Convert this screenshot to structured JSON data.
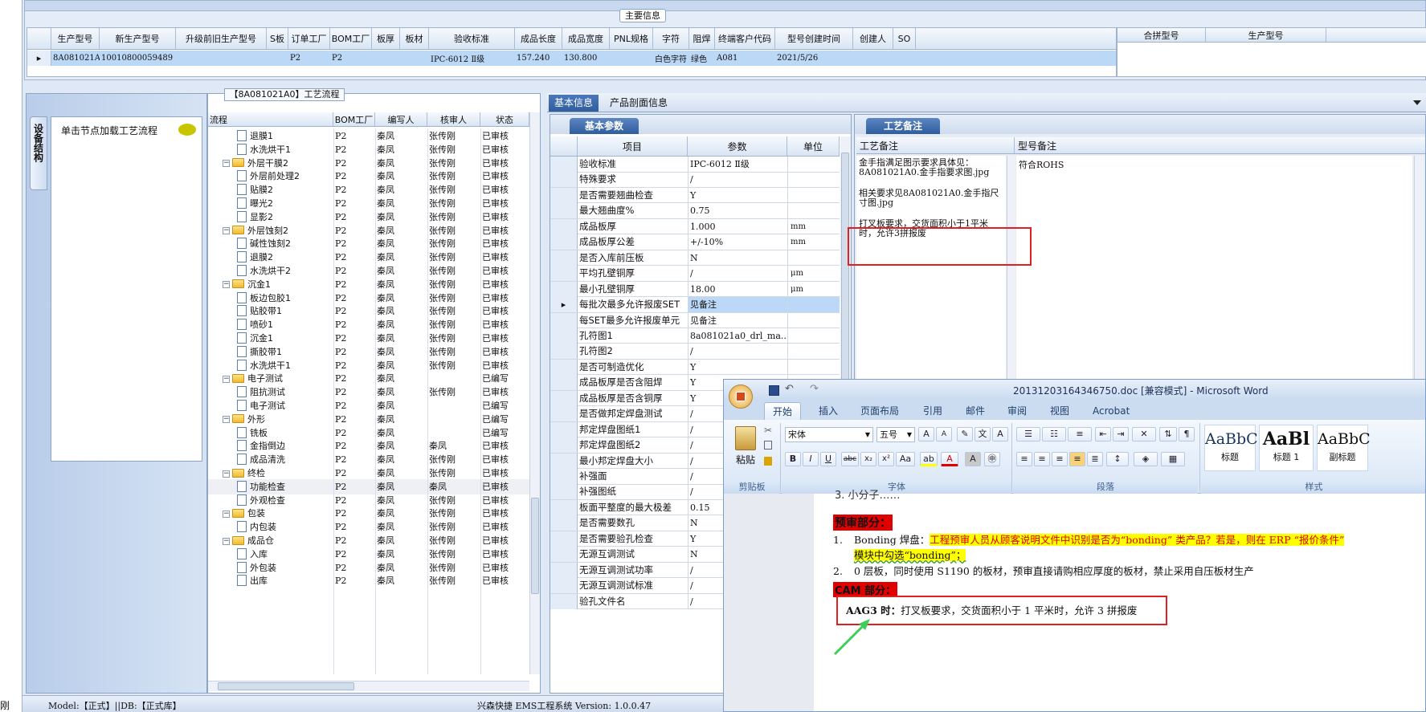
{
  "main_info": {
    "title": "主要信息",
    "headers": [
      "生产型号",
      "新生产型号",
      "升级前旧生产型号",
      "S板",
      "订单工厂",
      "BOM工厂",
      "板厚",
      "板材",
      "验收标准",
      "成品长度",
      "成品宽度",
      "PNL规格",
      "字符",
      "阻焊",
      "终端客户代码",
      "型号创建时间",
      "创建人",
      "SO"
    ],
    "row": [
      "8A081021A0",
      "10010800059489",
      "",
      "",
      "P2",
      "P2",
      "",
      "",
      "IPC-6012 Ⅱ级",
      "157.240",
      "130.800",
      "",
      "白色字符",
      "绿色",
      "A081",
      "2021/5/26",
      "",
      ""
    ],
    "side_headers": [
      "合拼型号",
      "生产型号"
    ]
  },
  "left_panel": {
    "vertical_tab": "设备结构",
    "hint": "单击节点加载工艺流程"
  },
  "flow": {
    "title": "【8A081021A0】工艺流程",
    "headers": [
      "流程",
      "BOM工厂",
      "编写人",
      "核审人",
      "状态"
    ],
    "rows": [
      {
        "name": "退膜1",
        "level": 2,
        "folder": false,
        "bom": "P2",
        "writer": "秦凤",
        "reviewer": "张传刚",
        "status": "已审核"
      },
      {
        "name": "水洗烘干1",
        "level": 2,
        "folder": false,
        "bom": "P2",
        "writer": "秦凤",
        "reviewer": "张传刚",
        "status": "已审核"
      },
      {
        "name": "外层干膜2",
        "level": 1,
        "folder": true,
        "bom": "P2",
        "writer": "秦凤",
        "reviewer": "张传刚",
        "status": "已审核"
      },
      {
        "name": "外层前处理2",
        "level": 2,
        "folder": false,
        "bom": "P2",
        "writer": "秦凤",
        "reviewer": "张传刚",
        "status": "已审核"
      },
      {
        "name": "贴膜2",
        "level": 2,
        "folder": false,
        "bom": "P2",
        "writer": "秦凤",
        "reviewer": "张传刚",
        "status": "已审核"
      },
      {
        "name": "曝光2",
        "level": 2,
        "folder": false,
        "bom": "P2",
        "writer": "秦凤",
        "reviewer": "张传刚",
        "status": "已审核"
      },
      {
        "name": "显影2",
        "level": 2,
        "folder": false,
        "bom": "P2",
        "writer": "秦凤",
        "reviewer": "张传刚",
        "status": "已审核"
      },
      {
        "name": "外层蚀刻2",
        "level": 1,
        "folder": true,
        "bom": "P2",
        "writer": "秦凤",
        "reviewer": "张传刚",
        "status": "已审核"
      },
      {
        "name": "碱性蚀刻2",
        "level": 2,
        "folder": false,
        "bom": "P2",
        "writer": "秦凤",
        "reviewer": "张传刚",
        "status": "已审核"
      },
      {
        "name": "退膜2",
        "level": 2,
        "folder": false,
        "bom": "P2",
        "writer": "秦凤",
        "reviewer": "张传刚",
        "status": "已审核"
      },
      {
        "name": "水洗烘干2",
        "level": 2,
        "folder": false,
        "bom": "P2",
        "writer": "秦凤",
        "reviewer": "张传刚",
        "status": "已审核"
      },
      {
        "name": "沉金1",
        "level": 1,
        "folder": true,
        "bom": "P2",
        "writer": "秦凤",
        "reviewer": "张传刚",
        "status": "已审核"
      },
      {
        "name": "板边包胶1",
        "level": 2,
        "folder": false,
        "bom": "P2",
        "writer": "秦凤",
        "reviewer": "张传刚",
        "status": "已审核"
      },
      {
        "name": "贴胶带1",
        "level": 2,
        "folder": false,
        "bom": "P2",
        "writer": "秦凤",
        "reviewer": "张传刚",
        "status": "已审核"
      },
      {
        "name": "喷砂1",
        "level": 2,
        "folder": false,
        "bom": "P2",
        "writer": "秦凤",
        "reviewer": "张传刚",
        "status": "已审核"
      },
      {
        "name": "沉金1",
        "level": 2,
        "folder": false,
        "bom": "P2",
        "writer": "秦凤",
        "reviewer": "张传刚",
        "status": "已审核"
      },
      {
        "name": "撕胶带1",
        "level": 2,
        "folder": false,
        "bom": "P2",
        "writer": "秦凤",
        "reviewer": "张传刚",
        "status": "已审核"
      },
      {
        "name": "水洗烘干1",
        "level": 2,
        "folder": false,
        "bom": "P2",
        "writer": "秦凤",
        "reviewer": "张传刚",
        "status": "已审核"
      },
      {
        "name": "电子测试",
        "level": 1,
        "folder": true,
        "bom": "P2",
        "writer": "秦凤",
        "reviewer": "",
        "status": "已编写"
      },
      {
        "name": "阻抗测试",
        "level": 2,
        "folder": false,
        "bom": "P2",
        "writer": "秦凤",
        "reviewer": "张传刚",
        "status": "已审核"
      },
      {
        "name": "电子测试",
        "level": 2,
        "folder": false,
        "bom": "P2",
        "writer": "秦凤",
        "reviewer": "",
        "status": "已编写"
      },
      {
        "name": "外形",
        "level": 1,
        "folder": true,
        "bom": "P2",
        "writer": "秦凤",
        "reviewer": "",
        "status": "已编写"
      },
      {
        "name": "铣板",
        "level": 2,
        "folder": false,
        "bom": "P2",
        "writer": "秦凤",
        "reviewer": "",
        "status": "已编写"
      },
      {
        "name": "金指倒边",
        "level": 2,
        "folder": false,
        "bom": "P2",
        "writer": "秦凤",
        "reviewer": "秦凤",
        "status": "已审核"
      },
      {
        "name": "成品清洗",
        "level": 2,
        "folder": false,
        "bom": "P2",
        "writer": "秦凤",
        "reviewer": "张传刚",
        "status": "已审核"
      },
      {
        "name": "终检",
        "level": 1,
        "folder": true,
        "bom": "P2",
        "writer": "秦凤",
        "reviewer": "张传刚",
        "status": "已审核"
      },
      {
        "name": "功能检查",
        "level": 2,
        "folder": false,
        "bom": "P2",
        "writer": "秦凤",
        "reviewer": "秦凤",
        "status": "已审核"
      },
      {
        "name": "外观检查",
        "level": 2,
        "folder": false,
        "bom": "P2",
        "writer": "秦凤",
        "reviewer": "张传刚",
        "status": "已审核"
      },
      {
        "name": "包装",
        "level": 1,
        "folder": true,
        "bom": "P2",
        "writer": "秦凤",
        "reviewer": "张传刚",
        "status": "已审核"
      },
      {
        "name": "内包装",
        "level": 2,
        "folder": false,
        "bom": "P2",
        "writer": "秦凤",
        "reviewer": "张传刚",
        "status": "已审核"
      },
      {
        "name": "成品仓",
        "level": 1,
        "folder": true,
        "bom": "P2",
        "writer": "秦凤",
        "reviewer": "张传刚",
        "status": "已审核"
      },
      {
        "name": "入库",
        "level": 2,
        "folder": false,
        "bom": "P2",
        "writer": "秦凤",
        "reviewer": "张传刚",
        "status": "已审核"
      },
      {
        "name": "外包装",
        "level": 2,
        "folder": false,
        "bom": "P2",
        "writer": "秦凤",
        "reviewer": "张传刚",
        "status": "已审核"
      },
      {
        "name": "出库",
        "level": 2,
        "folder": false,
        "bom": "P2",
        "writer": "秦凤",
        "reviewer": "张传刚",
        "status": "已审核"
      }
    ]
  },
  "tabs": {
    "basic_info": "基本信息",
    "profile_info": "产品剖面信息"
  },
  "params": {
    "title": "基本参数",
    "headers": [
      "项目",
      "参数",
      "单位"
    ],
    "rows": [
      {
        "item": "验收标准",
        "value": "IPC-6012 Ⅱ级",
        "unit": ""
      },
      {
        "item": "特殊要求",
        "value": "/",
        "unit": ""
      },
      {
        "item": "是否需要翘曲检查",
        "value": "Y",
        "unit": ""
      },
      {
        "item": "最大翘曲度%",
        "value": "0.75",
        "unit": ""
      },
      {
        "item": "成品板厚",
        "value": "1.000",
        "unit": "mm"
      },
      {
        "item": "成品板厚公差",
        "value": "+/-10%",
        "unit": "mm"
      },
      {
        "item": "是否入库前压板",
        "value": "N",
        "unit": ""
      },
      {
        "item": "平均孔壁铜厚",
        "value": "/",
        "unit": "μm"
      },
      {
        "item": "最小孔壁铜厚",
        "value": "18.00",
        "unit": "μm"
      },
      {
        "item": "每批次最多允许报废SET",
        "value": "见备注",
        "unit": ""
      },
      {
        "item": "每SET最多允许报废单元",
        "value": "见备注",
        "unit": ""
      },
      {
        "item": "孔符图1",
        "value": "8a081021a0_drl_ma...",
        "unit": ""
      },
      {
        "item": "孔符图2",
        "value": "/",
        "unit": ""
      },
      {
        "item": "是否可制造优化",
        "value": "Y",
        "unit": ""
      },
      {
        "item": "成品板厚是否含阻焊",
        "value": "Y",
        "unit": ""
      },
      {
        "item": "成品板厚是否含铜厚",
        "value": "Y",
        "unit": ""
      },
      {
        "item": "是否做邦定焊盘测试",
        "value": "/",
        "unit": ""
      },
      {
        "item": "邦定焊盘图纸1",
        "value": "/",
        "unit": ""
      },
      {
        "item": "邦定焊盘图纸2",
        "value": "/",
        "unit": ""
      },
      {
        "item": "最小邦定焊盘大小",
        "value": "/",
        "unit": ""
      },
      {
        "item": "补强面",
        "value": "/",
        "unit": ""
      },
      {
        "item": "补强图纸",
        "value": "/",
        "unit": ""
      },
      {
        "item": "板面平整度的最大极差",
        "value": "0.15",
        "unit": ""
      },
      {
        "item": "是否需要数孔",
        "value": "N",
        "unit": ""
      },
      {
        "item": "是否需要验孔检查",
        "value": "Y",
        "unit": ""
      },
      {
        "item": "无源互调测试",
        "value": "N",
        "unit": ""
      },
      {
        "item": "无源互调测试功率",
        "value": "/",
        "unit": ""
      },
      {
        "item": "无源互调测试标准",
        "value": "/",
        "unit": ""
      },
      {
        "item": "验孔文件名",
        "value": "/",
        "unit": ""
      }
    ]
  },
  "remarks": {
    "title": "工艺备注",
    "col1": "工艺备注",
    "col2": "型号备注",
    "p1": "金手指满足图示要求具体见：8A081021A0.金手指要求图.jpg",
    "p2": "相关要求见8A081021A0.金手指尺寸图.jpg",
    "p3": "打叉板要求，交货面积小于1平米时，允许3拼报废",
    "model_note": "符合ROHS"
  },
  "word": {
    "title": "20131203164346750.doc [兼容模式] - Microsoft Word",
    "tabs": [
      "开始",
      "插入",
      "页面布局",
      "引用",
      "邮件",
      "审阅",
      "视图",
      "Acrobat"
    ],
    "paste": "粘贴",
    "font_name": "宋体",
    "font_size": "五号",
    "groups": [
      "剪贴板",
      "字体",
      "段落",
      "样式"
    ],
    "styles": [
      {
        "preview": "AaBbC",
        "name": "标题"
      },
      {
        "preview": "AaBl",
        "name": "标题 1"
      },
      {
        "preview": "AaBbC",
        "name": "副标题"
      }
    ],
    "doc": {
      "top_partial": "3. 小分子……",
      "section1": "预审部分：",
      "item1_num": "1.",
      "item1_lead": "Bonding 焊盘：",
      "item1_highlight_a": "工程预审人员",
      "item1_red": "从顾客说明文件中识别是否为“bonding” 类产品？若是，则在 ERP “报价条件”",
      "item1_highlight_b": "模块中勾选“bonding”；",
      "item2_num": "2.",
      "item2": "0 层板，同时使用 S1190 的板材，预审直接请购相应厚度的板材，禁止采用自压板材生产",
      "section2": "CAM 部分：",
      "aag3_lead": "AAG3 时：",
      "aag3_text": "打叉板要求，交货面积小于 1 平米时，允许 3 拼报废"
    }
  },
  "status_bar": {
    "left_cut": "刚",
    "model": "Model:【正式】||DB:【正式库】",
    "system": "兴森快捷 EMS工程系统 Version: 1.0.0.47"
  },
  "colors": {
    "highlight_red": "#e00000",
    "highlight_yellow": "#ffff00",
    "accent_blue": "#2f5d9d"
  }
}
